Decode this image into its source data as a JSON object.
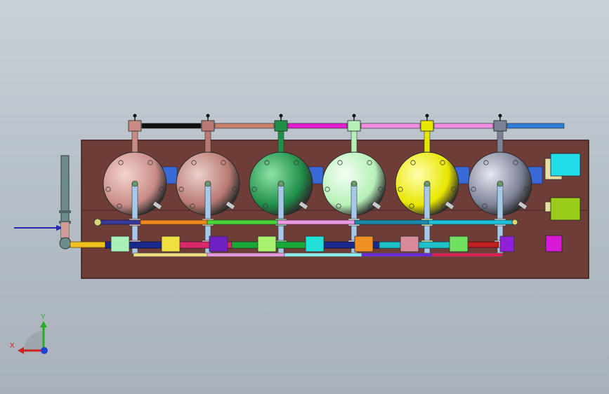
{
  "scene": {
    "background_top": "#c9d1d8",
    "background_bottom": "#a9b2ba",
    "base_plate_color": "#6e3d38",
    "base_plate_edge": "#3a1d1a"
  },
  "tanks": [
    {
      "color": "#c98c87",
      "highlight": "#f3d4d0"
    },
    {
      "color": "#b87a72",
      "highlight": "#eed0cc"
    },
    {
      "color": "#1f8f4a",
      "highlight": "#8fe3a8"
    },
    {
      "color": "#b6f0b8",
      "highlight": "#f4fff4"
    },
    {
      "color": "#e8e600",
      "highlight": "#ffffb0"
    },
    {
      "color": "#7c8296",
      "highlight": "#e6e8f2"
    }
  ],
  "top_header_segments": [
    "#111111",
    "#c77f6e",
    "#e020d0",
    "#f08ee0",
    "#f08ee0",
    "#2f7fd8"
  ],
  "side_boxes": [
    "#22dde8",
    "#9acd1a",
    "#d81ad8"
  ],
  "triad": {
    "x_label": "X",
    "y_label": "Y",
    "x_color": "#d42020",
    "y_color": "#20b020",
    "z_color": "#2040d0"
  }
}
